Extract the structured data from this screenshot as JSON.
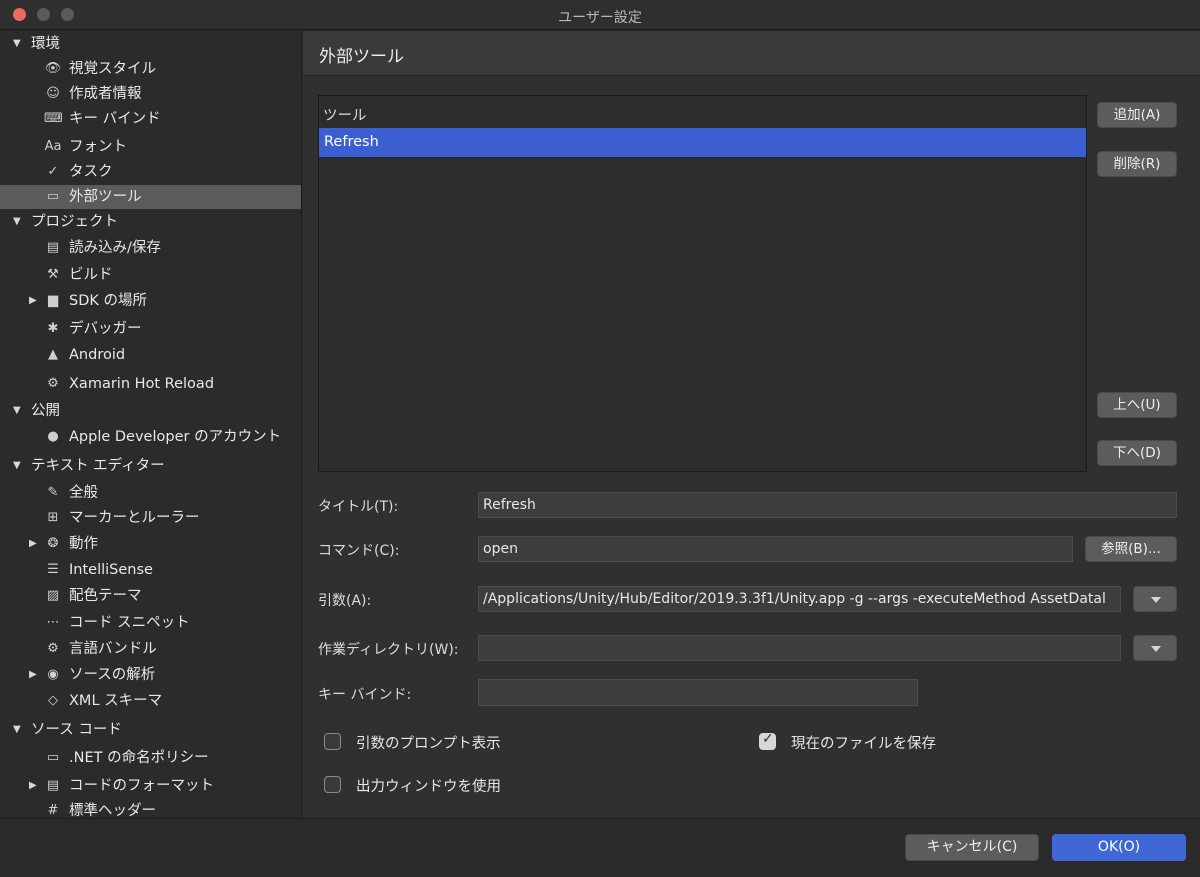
{
  "window": {
    "title": "ユーザー設定"
  },
  "sidebar": {
    "items": [
      {
        "label": "環境",
        "level": 0,
        "expanded": true,
        "icon": ""
      },
      {
        "label": "視覚スタイル",
        "level": 1,
        "icon": "eye-icon",
        "glyph": "👁"
      },
      {
        "label": "作成者情報",
        "level": 1,
        "icon": "smiley-icon",
        "glyph": "☺"
      },
      {
        "label": "キー バインド",
        "level": 1,
        "icon": "key-binding-icon",
        "glyph": "⌨"
      },
      {
        "label": "フォント",
        "level": 1,
        "icon": "font-icon",
        "glyph": "Aa"
      },
      {
        "label": "タスク",
        "level": 1,
        "icon": "check-icon",
        "glyph": "✓"
      },
      {
        "label": "外部ツール",
        "level": 1,
        "icon": "terminal-icon",
        "glyph": "▭",
        "selected": true
      },
      {
        "label": "プロジェクト",
        "level": 0,
        "expanded": true,
        "icon": ""
      },
      {
        "label": "読み込み/保存",
        "level": 1,
        "icon": "disk-icon",
        "glyph": "▤"
      },
      {
        "label": "ビルド",
        "level": 1,
        "icon": "hammer-icon",
        "glyph": "⚒"
      },
      {
        "label": "SDK の場所",
        "level": 1,
        "icon": "folder-icon",
        "glyph": "▆",
        "collapsed": true
      },
      {
        "label": "デバッガー",
        "level": 1,
        "icon": "bug-icon",
        "glyph": "✱"
      },
      {
        "label": "Android",
        "level": 1,
        "icon": "android-icon",
        "glyph": "▲"
      },
      {
        "label": "Xamarin Hot Reload",
        "level": 1,
        "icon": "gear-icon",
        "glyph": "⚙"
      },
      {
        "label": "公開",
        "level": 0,
        "expanded": true,
        "icon": ""
      },
      {
        "label": "Apple Developer のアカウント",
        "level": 1,
        "icon": "apple-icon",
        "glyph": "●"
      },
      {
        "label": "テキスト エディター",
        "level": 0,
        "expanded": true,
        "icon": ""
      },
      {
        "label": "全般",
        "level": 1,
        "icon": "edit-icon",
        "glyph": "✎"
      },
      {
        "label": "マーカーとルーラー",
        "level": 1,
        "icon": "ruler-icon",
        "glyph": "⊞"
      },
      {
        "label": "動作",
        "level": 1,
        "icon": "brain-icon",
        "glyph": "❂",
        "collapsed": true
      },
      {
        "label": "IntelliSense",
        "level": 1,
        "icon": "list-icon",
        "glyph": "☰"
      },
      {
        "label": "配色テーマ",
        "level": 1,
        "icon": "palette-icon",
        "glyph": "▨"
      },
      {
        "label": "コード スニペット",
        "level": 1,
        "icon": "snippet-icon",
        "glyph": "⋯"
      },
      {
        "label": "言語バンドル",
        "level": 1,
        "icon": "gear-icon",
        "glyph": "⚙"
      },
      {
        "label": "ソースの解析",
        "level": 1,
        "icon": "target-icon",
        "glyph": "◉",
        "collapsed": true
      },
      {
        "label": "XML スキーマ",
        "level": 1,
        "icon": "xml-icon",
        "glyph": "◇"
      },
      {
        "label": "ソース コード",
        "level": 0,
        "expanded": true,
        "icon": ""
      },
      {
        "label": ".NET の命名ポリシー",
        "level": 1,
        "icon": "naming-icon",
        "glyph": "▭"
      },
      {
        "label": "コードのフォーマット",
        "level": 1,
        "icon": "format-icon",
        "glyph": "▤",
        "collapsed": true
      },
      {
        "label": "標準ヘッダー",
        "level": 1,
        "icon": "hash-icon",
        "glyph": "#"
      }
    ]
  },
  "main": {
    "title": "外部ツール",
    "tool_list": {
      "column_header": "ツール",
      "items": [
        "Refresh"
      ],
      "selected_index": 0
    },
    "buttons": {
      "add": "追加(A)",
      "remove": "削除(R)",
      "up": "上へ(U)",
      "down": "下へ(D)",
      "browse": "参照(B)..."
    },
    "fields": {
      "title_label": "タイトル(T):",
      "title_value": "Refresh",
      "command_label": "コマンド(C):",
      "command_value": "open",
      "args_label": "引数(A):",
      "args_value": "/Applications/Unity/Hub/Editor/2019.3.3f1/Unity.app -g --args -executeMethod AssetDatal",
      "workdir_label": "作業ディレクトリ(W):",
      "workdir_value": "",
      "keybind_label": "キー バインド:",
      "keybind_value": ""
    },
    "options": {
      "prompt_args": {
        "label": "引数のプロンプト表示",
        "checked": false
      },
      "save_file": {
        "label": "現在のファイルを保存",
        "checked": true
      },
      "use_output": {
        "label": "出力ウィンドウを使用",
        "checked": false
      }
    }
  },
  "footer": {
    "cancel": "キャンセル(C)",
    "ok": "OK(O)"
  },
  "colors": {
    "accent": "#3b5fd0",
    "ok_button": "#3f68d6"
  }
}
